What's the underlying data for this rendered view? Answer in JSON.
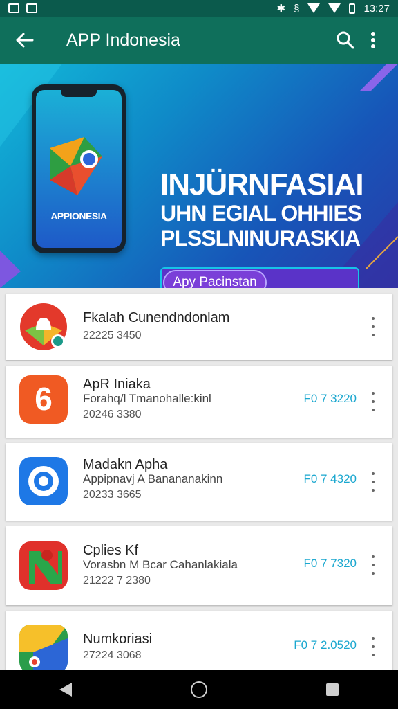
{
  "status_bar": {
    "time": "13:27"
  },
  "app_bar": {
    "title": "APP Indonesia"
  },
  "banner": {
    "phone_brand": "APPIONESIA",
    "headline": "INJÜRNFASIAI",
    "line2": "UHN EGIAL OHHIES",
    "line3": "PLSSLNINURASKIA",
    "cta_label": "Apy Pacinstan"
  },
  "apps": [
    {
      "name": "Fkalah Cunendndonlam",
      "meta": "22225 3450"
    },
    {
      "name": "ApR Iniaka",
      "subtitle": "Forahq/l Tmanohalle:kinl",
      "meta": "20246 3380",
      "price": "F0 7 3220"
    },
    {
      "name": "Madakn Apha",
      "subtitle": "Appipnavj A Banananakinn",
      "meta": "20233 3665",
      "price": "F0 7 4320"
    },
    {
      "name": "Cplies Kf",
      "subtitle": "Vorasbn M Bcar Cahanlakiala",
      "meta": "21222 7 2380",
      "price": "F0 7 7320"
    },
    {
      "name": "Numkoriasi",
      "meta": "27224 3068",
      "price": "F0 7 2.0520"
    }
  ]
}
